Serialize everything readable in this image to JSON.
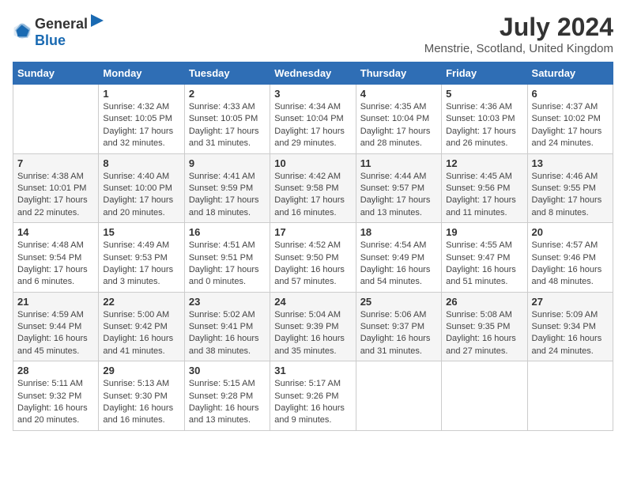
{
  "header": {
    "logo_general": "General",
    "logo_blue": "Blue",
    "month_title": "July 2024",
    "location": "Menstrie, Scotland, United Kingdom"
  },
  "weekdays": [
    "Sunday",
    "Monday",
    "Tuesday",
    "Wednesday",
    "Thursday",
    "Friday",
    "Saturday"
  ],
  "weeks": [
    [
      {
        "day": "",
        "sunrise": "",
        "sunset": "",
        "daylight": ""
      },
      {
        "day": "1",
        "sunrise": "Sunrise: 4:32 AM",
        "sunset": "Sunset: 10:05 PM",
        "daylight": "Daylight: 17 hours and 32 minutes."
      },
      {
        "day": "2",
        "sunrise": "Sunrise: 4:33 AM",
        "sunset": "Sunset: 10:05 PM",
        "daylight": "Daylight: 17 hours and 31 minutes."
      },
      {
        "day": "3",
        "sunrise": "Sunrise: 4:34 AM",
        "sunset": "Sunset: 10:04 PM",
        "daylight": "Daylight: 17 hours and 29 minutes."
      },
      {
        "day": "4",
        "sunrise": "Sunrise: 4:35 AM",
        "sunset": "Sunset: 10:04 PM",
        "daylight": "Daylight: 17 hours and 28 minutes."
      },
      {
        "day": "5",
        "sunrise": "Sunrise: 4:36 AM",
        "sunset": "Sunset: 10:03 PM",
        "daylight": "Daylight: 17 hours and 26 minutes."
      },
      {
        "day": "6",
        "sunrise": "Sunrise: 4:37 AM",
        "sunset": "Sunset: 10:02 PM",
        "daylight": "Daylight: 17 hours and 24 minutes."
      }
    ],
    [
      {
        "day": "7",
        "sunrise": "Sunrise: 4:38 AM",
        "sunset": "Sunset: 10:01 PM",
        "daylight": "Daylight: 17 hours and 22 minutes."
      },
      {
        "day": "8",
        "sunrise": "Sunrise: 4:40 AM",
        "sunset": "Sunset: 10:00 PM",
        "daylight": "Daylight: 17 hours and 20 minutes."
      },
      {
        "day": "9",
        "sunrise": "Sunrise: 4:41 AM",
        "sunset": "Sunset: 9:59 PM",
        "daylight": "Daylight: 17 hours and 18 minutes."
      },
      {
        "day": "10",
        "sunrise": "Sunrise: 4:42 AM",
        "sunset": "Sunset: 9:58 PM",
        "daylight": "Daylight: 17 hours and 16 minutes."
      },
      {
        "day": "11",
        "sunrise": "Sunrise: 4:44 AM",
        "sunset": "Sunset: 9:57 PM",
        "daylight": "Daylight: 17 hours and 13 minutes."
      },
      {
        "day": "12",
        "sunrise": "Sunrise: 4:45 AM",
        "sunset": "Sunset: 9:56 PM",
        "daylight": "Daylight: 17 hours and 11 minutes."
      },
      {
        "day": "13",
        "sunrise": "Sunrise: 4:46 AM",
        "sunset": "Sunset: 9:55 PM",
        "daylight": "Daylight: 17 hours and 8 minutes."
      }
    ],
    [
      {
        "day": "14",
        "sunrise": "Sunrise: 4:48 AM",
        "sunset": "Sunset: 9:54 PM",
        "daylight": "Daylight: 17 hours and 6 minutes."
      },
      {
        "day": "15",
        "sunrise": "Sunrise: 4:49 AM",
        "sunset": "Sunset: 9:53 PM",
        "daylight": "Daylight: 17 hours and 3 minutes."
      },
      {
        "day": "16",
        "sunrise": "Sunrise: 4:51 AM",
        "sunset": "Sunset: 9:51 PM",
        "daylight": "Daylight: 17 hours and 0 minutes."
      },
      {
        "day": "17",
        "sunrise": "Sunrise: 4:52 AM",
        "sunset": "Sunset: 9:50 PM",
        "daylight": "Daylight: 16 hours and 57 minutes."
      },
      {
        "day": "18",
        "sunrise": "Sunrise: 4:54 AM",
        "sunset": "Sunset: 9:49 PM",
        "daylight": "Daylight: 16 hours and 54 minutes."
      },
      {
        "day": "19",
        "sunrise": "Sunrise: 4:55 AM",
        "sunset": "Sunset: 9:47 PM",
        "daylight": "Daylight: 16 hours and 51 minutes."
      },
      {
        "day": "20",
        "sunrise": "Sunrise: 4:57 AM",
        "sunset": "Sunset: 9:46 PM",
        "daylight": "Daylight: 16 hours and 48 minutes."
      }
    ],
    [
      {
        "day": "21",
        "sunrise": "Sunrise: 4:59 AM",
        "sunset": "Sunset: 9:44 PM",
        "daylight": "Daylight: 16 hours and 45 minutes."
      },
      {
        "day": "22",
        "sunrise": "Sunrise: 5:00 AM",
        "sunset": "Sunset: 9:42 PM",
        "daylight": "Daylight: 16 hours and 41 minutes."
      },
      {
        "day": "23",
        "sunrise": "Sunrise: 5:02 AM",
        "sunset": "Sunset: 9:41 PM",
        "daylight": "Daylight: 16 hours and 38 minutes."
      },
      {
        "day": "24",
        "sunrise": "Sunrise: 5:04 AM",
        "sunset": "Sunset: 9:39 PM",
        "daylight": "Daylight: 16 hours and 35 minutes."
      },
      {
        "day": "25",
        "sunrise": "Sunrise: 5:06 AM",
        "sunset": "Sunset: 9:37 PM",
        "daylight": "Daylight: 16 hours and 31 minutes."
      },
      {
        "day": "26",
        "sunrise": "Sunrise: 5:08 AM",
        "sunset": "Sunset: 9:35 PM",
        "daylight": "Daylight: 16 hours and 27 minutes."
      },
      {
        "day": "27",
        "sunrise": "Sunrise: 5:09 AM",
        "sunset": "Sunset: 9:34 PM",
        "daylight": "Daylight: 16 hours and 24 minutes."
      }
    ],
    [
      {
        "day": "28",
        "sunrise": "Sunrise: 5:11 AM",
        "sunset": "Sunset: 9:32 PM",
        "daylight": "Daylight: 16 hours and 20 minutes."
      },
      {
        "day": "29",
        "sunrise": "Sunrise: 5:13 AM",
        "sunset": "Sunset: 9:30 PM",
        "daylight": "Daylight: 16 hours and 16 minutes."
      },
      {
        "day": "30",
        "sunrise": "Sunrise: 5:15 AM",
        "sunset": "Sunset: 9:28 PM",
        "daylight": "Daylight: 16 hours and 13 minutes."
      },
      {
        "day": "31",
        "sunrise": "Sunrise: 5:17 AM",
        "sunset": "Sunset: 9:26 PM",
        "daylight": "Daylight: 16 hours and 9 minutes."
      },
      {
        "day": "",
        "sunrise": "",
        "sunset": "",
        "daylight": ""
      },
      {
        "day": "",
        "sunrise": "",
        "sunset": "",
        "daylight": ""
      },
      {
        "day": "",
        "sunrise": "",
        "sunset": "",
        "daylight": ""
      }
    ]
  ]
}
